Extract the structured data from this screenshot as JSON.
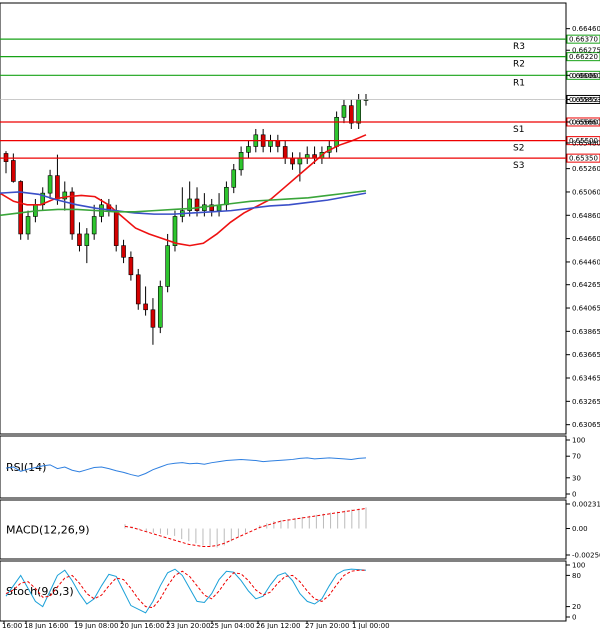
{
  "chart_data": {
    "type": "candlestick",
    "symbol_note": "",
    "price_axis": {
      "ylim": [
        0.62985,
        0.6668
      ],
      "ticks": [
        "0.66460",
        "0.66275",
        "0.66060",
        "0.65853",
        "0.65660",
        "0.65480",
        "0.65260",
        "0.65060",
        "0.64860",
        "0.64660",
        "0.64460",
        "0.64265",
        "0.64065",
        "0.63865",
        "0.63665",
        "0.63465",
        "0.63265",
        "0.63065"
      ]
    },
    "time_axis": {
      "labels": [
        "16:00",
        "18 Jun 16:00",
        "19 Jun 08:00",
        "20 Jun 16:00",
        "23 Jun 20:00",
        "25 Jun 04:00",
        "26 Jun 12:00",
        "27 Jun 20:00",
        "1 Jul 00:00"
      ]
    },
    "current_price": "0.65853",
    "levels": {
      "resistance": [
        {
          "name": "R3",
          "value": "0.66370"
        },
        {
          "name": "R2",
          "value": "0.66220"
        },
        {
          "name": "R1",
          "value": "0.66060"
        }
      ],
      "support": [
        {
          "name": "S1",
          "value": "0.65660"
        },
        {
          "name": "S2",
          "value": "0.65500"
        },
        {
          "name": "S3",
          "value": "0.65350"
        }
      ]
    },
    "ohlc": [
      [
        0.6539,
        0.6541,
        0.6522,
        0.6532
      ],
      [
        0.6533,
        0.6539,
        0.6514,
        0.6515
      ],
      [
        0.6515,
        0.6516,
        0.6465,
        0.647
      ],
      [
        0.647,
        0.649,
        0.6465,
        0.6485
      ],
      [
        0.6485,
        0.65,
        0.648,
        0.6495
      ],
      [
        0.6495,
        0.651,
        0.649,
        0.6505
      ],
      [
        0.6505,
        0.6525,
        0.65,
        0.652
      ],
      [
        0.652,
        0.6538,
        0.6495,
        0.65
      ],
      [
        0.65,
        0.6515,
        0.649,
        0.6506
      ],
      [
        0.6506,
        0.651,
        0.6465,
        0.647
      ],
      [
        0.647,
        0.648,
        0.6455,
        0.646
      ],
      [
        0.646,
        0.6475,
        0.6445,
        0.647
      ],
      [
        0.647,
        0.6495,
        0.6465,
        0.6485
      ],
      [
        0.6485,
        0.65,
        0.648,
        0.6495
      ],
      [
        0.6495,
        0.65,
        0.6485,
        0.649
      ],
      [
        0.649,
        0.6495,
        0.6455,
        0.646
      ],
      [
        0.646,
        0.6465,
        0.6445,
        0.645
      ],
      [
        0.645,
        0.6455,
        0.643,
        0.6435
      ],
      [
        0.6435,
        0.644,
        0.6405,
        0.641
      ],
      [
        0.641,
        0.6425,
        0.64,
        0.6405
      ],
      [
        0.6405,
        0.6415,
        0.6375,
        0.639
      ],
      [
        0.639,
        0.643,
        0.6385,
        0.6425
      ],
      [
        0.6425,
        0.647,
        0.642,
        0.646
      ],
      [
        0.646,
        0.649,
        0.6455,
        0.6485
      ],
      [
        0.6485,
        0.651,
        0.648,
        0.649
      ],
      [
        0.649,
        0.6515,
        0.6485,
        0.65
      ],
      [
        0.65,
        0.651,
        0.6485,
        0.649
      ],
      [
        0.649,
        0.6505,
        0.6485,
        0.6495
      ],
      [
        0.6495,
        0.65,
        0.6485,
        0.649
      ],
      [
        0.649,
        0.6505,
        0.6485,
        0.6495
      ],
      [
        0.6495,
        0.6515,
        0.649,
        0.651
      ],
      [
        0.651,
        0.653,
        0.6505,
        0.6525
      ],
      [
        0.6525,
        0.6545,
        0.652,
        0.654
      ],
      [
        0.654,
        0.655,
        0.6535,
        0.6545
      ],
      [
        0.6545,
        0.656,
        0.654,
        0.6555
      ],
      [
        0.6555,
        0.656,
        0.654,
        0.6545
      ],
      [
        0.6545,
        0.6555,
        0.654,
        0.655
      ],
      [
        0.655,
        0.6555,
        0.654,
        0.6545
      ],
      [
        0.6545,
        0.655,
        0.653,
        0.6535
      ],
      [
        0.6535,
        0.654,
        0.6525,
        0.653
      ],
      [
        0.653,
        0.654,
        0.6515,
        0.6535
      ],
      [
        0.6535,
        0.6545,
        0.653,
        0.6538
      ],
      [
        0.6538,
        0.6545,
        0.653,
        0.6535
      ],
      [
        0.6535,
        0.6545,
        0.653,
        0.654
      ],
      [
        0.654,
        0.655,
        0.6535,
        0.6545
      ],
      [
        0.6545,
        0.6575,
        0.654,
        0.657
      ],
      [
        0.657,
        0.6585,
        0.6565,
        0.658
      ],
      [
        0.658,
        0.6585,
        0.656,
        0.6565
      ],
      [
        0.6565,
        0.659,
        0.656,
        0.6585
      ],
      [
        0.6585,
        0.659,
        0.658,
        0.65853
      ]
    ],
    "ma_red": [
      0.6505,
      0.6498,
      0.6495,
      0.6495,
      0.65,
      0.6502,
      0.6503,
      0.6502,
      0.6495,
      0.6485,
      0.6475,
      0.647,
      0.6466,
      0.6462,
      0.646,
      0.6462,
      0.647,
      0.648,
      0.6488,
      0.6494,
      0.65,
      0.651,
      0.652,
      0.653,
      0.654,
      0.6546,
      0.655,
      0.6555
    ],
    "ma_blue": [
      0.6505,
      0.6506,
      0.6504,
      0.6499,
      0.6495,
      0.6492,
      0.649,
      0.6488,
      0.6487,
      0.6487,
      0.6488,
      0.6489,
      0.649,
      0.6492,
      0.6494,
      0.6495,
      0.6497,
      0.6499,
      0.6502,
      0.6505
    ],
    "ma_green": [
      0.6486,
      0.6488,
      0.649,
      0.6491,
      0.6491,
      0.649,
      0.6489,
      0.6489,
      0.649,
      0.6491,
      0.6492,
      0.6494,
      0.6496,
      0.6498,
      0.6499,
      0.65,
      0.6501,
      0.6503,
      0.6505,
      0.6507
    ],
    "indicators": [
      {
        "label": "RSI(14)",
        "ticks": [
          "100",
          "70",
          "30",
          "0"
        ],
        "ylim": [
          0,
          100
        ],
        "values": [
          48,
          50,
          42,
          46,
          49,
          52,
          54,
          47,
          50,
          44,
          41,
          45,
          49,
          50,
          47,
          43,
          40,
          36,
          33,
          38,
          45,
          50,
          55,
          57,
          58,
          56,
          57,
          55,
          58,
          60,
          62,
          63,
          64,
          63,
          62,
          60,
          61,
          62,
          63,
          64,
          66,
          67,
          65,
          66,
          67,
          66,
          65,
          64,
          66,
          67
        ]
      },
      {
        "label": "MACD(12,26,9)",
        "ticks": [
          "0.002319",
          "0.00",
          "-0.002504"
        ],
        "ylim": [
          -0.002504,
          0.002319
        ],
        "hist": [
          0.0004,
          0.0002,
          -0.0001,
          -0.0003,
          -0.0004,
          -0.0005,
          -0.0006,
          -0.0007,
          -0.001,
          -0.0012,
          -0.0014,
          -0.0016,
          -0.0017,
          -0.0018,
          -0.0016,
          -0.0012,
          -0.0008,
          -0.0004,
          0.0,
          0.0003,
          0.0005,
          0.0007,
          0.0008,
          0.0009,
          0.001,
          0.0011,
          0.0012,
          0.0013,
          0.0014,
          0.0015,
          0.0016,
          0.0017,
          0.0018,
          0.0019,
          0.002
        ],
        "signal": [
          0.0002,
          0.0001,
          -0.0001,
          -0.0003,
          -0.0005,
          -0.0007,
          -0.0009,
          -0.0011,
          -0.0013,
          -0.0015,
          -0.0016,
          -0.0017,
          -0.0017,
          -0.0016,
          -0.0014,
          -0.0011,
          -0.0008,
          -0.0005,
          -0.0002,
          0.0001,
          0.0003,
          0.0005,
          0.0007,
          0.0008,
          0.0009,
          0.001,
          0.0011,
          0.0012,
          0.0013,
          0.0014,
          0.0015,
          0.0016,
          0.0017,
          0.0018,
          0.0019
        ]
      },
      {
        "label": "Stoch(9,6,3)",
        "ticks": [
          "100",
          "80",
          "20",
          "0"
        ],
        "ylim": [
          0,
          100
        ],
        "k": [
          40,
          60,
          80,
          55,
          30,
          20,
          50,
          80,
          90,
          70,
          45,
          25,
          35,
          60,
          82,
          78,
          50,
          22,
          15,
          8,
          30,
          60,
          85,
          92,
          80,
          55,
          30,
          28,
          45,
          72,
          88,
          86,
          70,
          50,
          35,
          40,
          62,
          80,
          85,
          70,
          45,
          30,
          25,
          35,
          60,
          82,
          90,
          92,
          91,
          90
        ],
        "d": [
          45,
          52,
          65,
          68,
          55,
          38,
          40,
          58,
          75,
          80,
          65,
          45,
          35,
          42,
          60,
          75,
          72,
          55,
          35,
          20,
          18,
          35,
          60,
          80,
          88,
          78,
          60,
          42,
          35,
          50,
          70,
          85,
          83,
          70,
          52,
          42,
          48,
          65,
          78,
          80,
          68,
          50,
          35,
          30,
          42,
          62,
          80,
          88,
          90,
          90
        ]
      }
    ]
  }
}
